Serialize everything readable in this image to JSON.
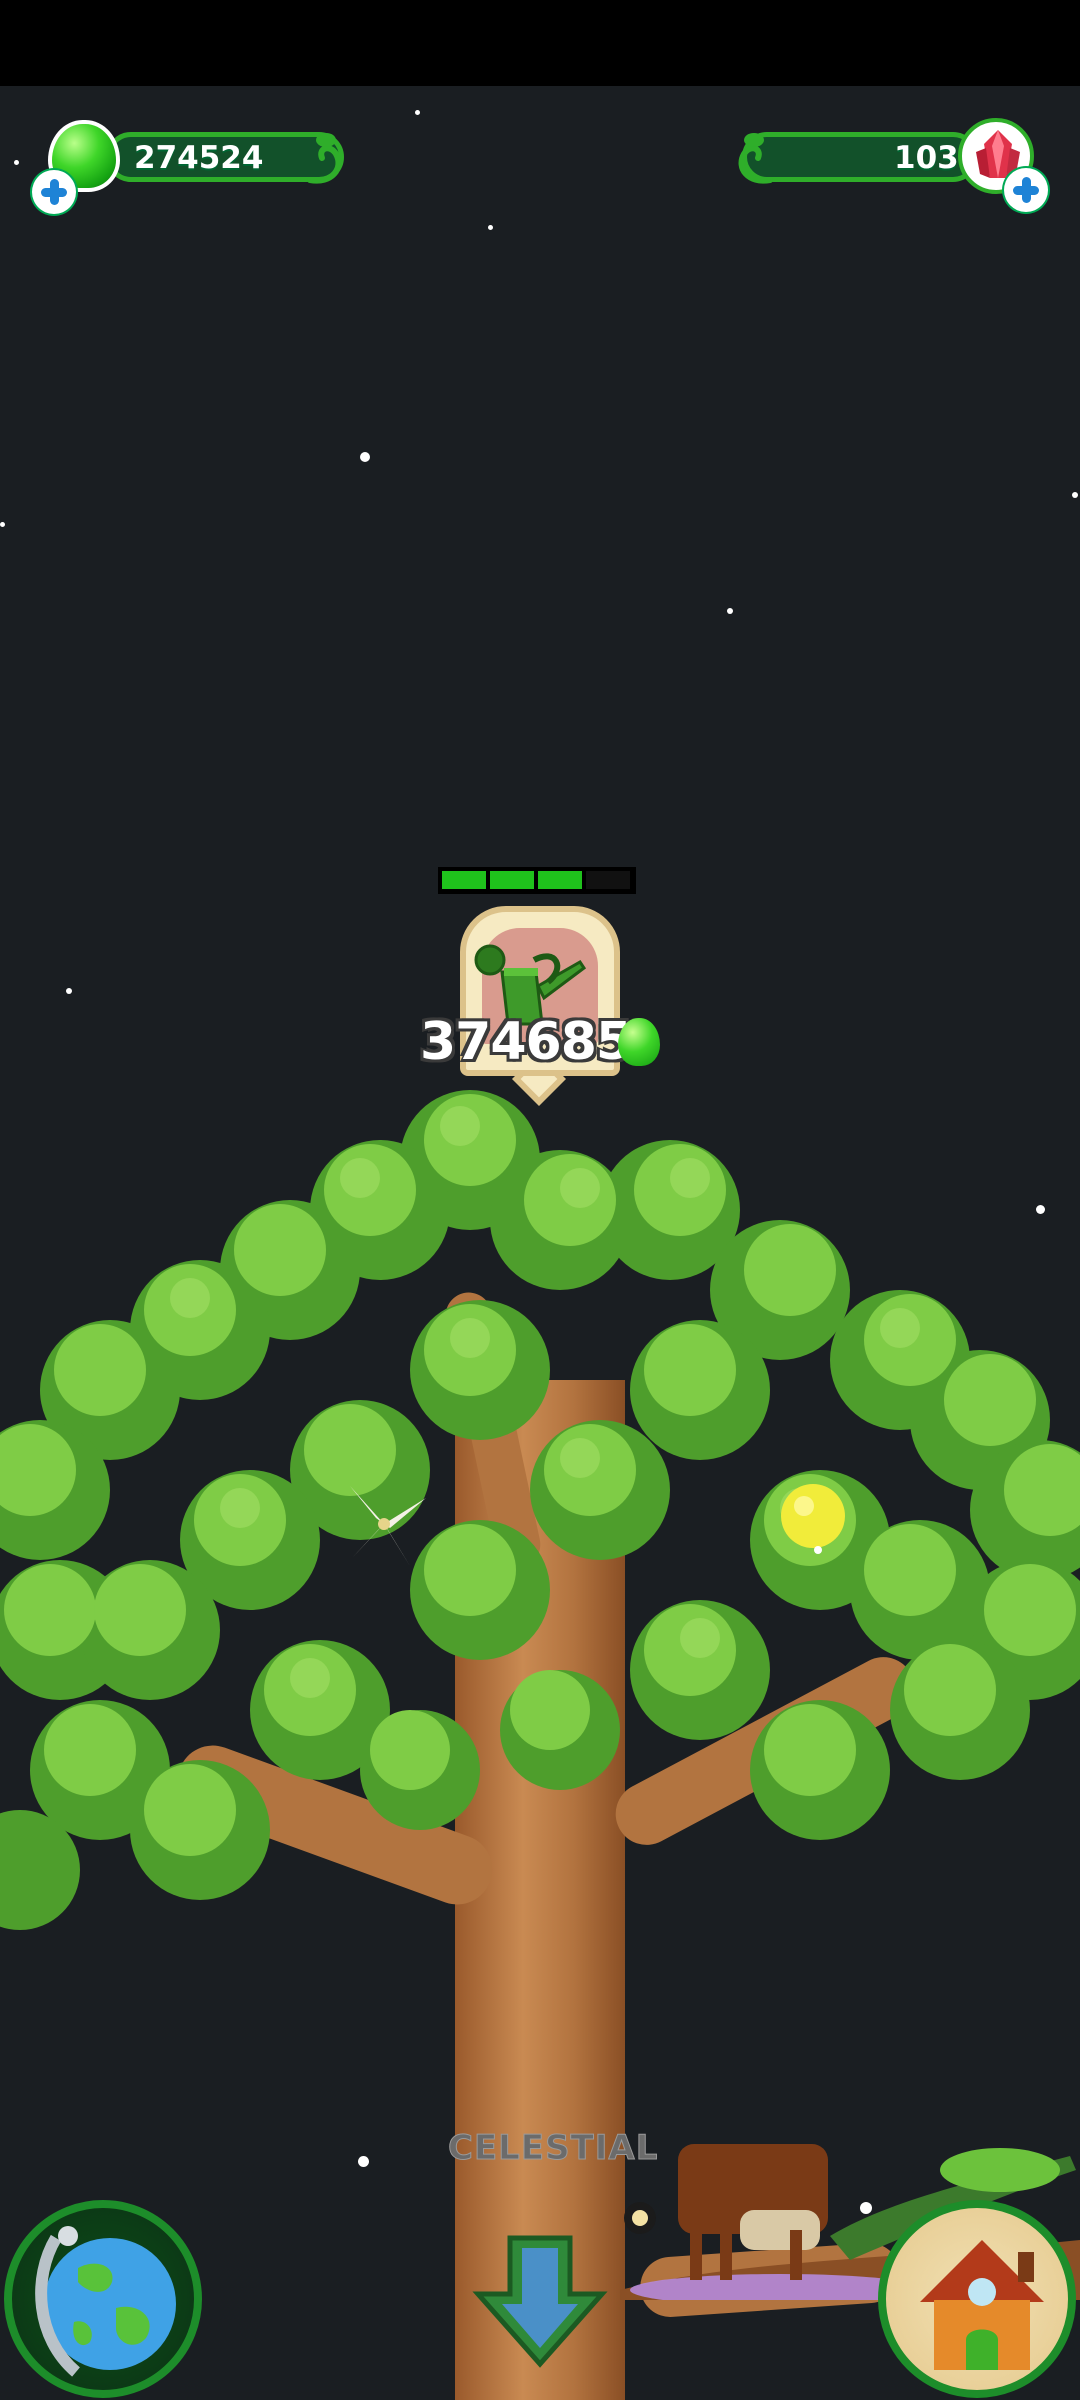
{
  "hud": {
    "gems": "274524",
    "crystals": "103",
    "gem_icon": "green-gem-icon",
    "crystal_icon": "red-crystal-icon"
  },
  "tree": {
    "progress_filled": 3,
    "progress_total": 4,
    "task_icon": "watering-can-icon",
    "reward": "374685",
    "zone_label": "CELESTIAL"
  },
  "nav": {
    "left_button_icon": "globe-icon",
    "center_button_icon": "down-arrow-icon",
    "right_button_icon": "house-icon"
  },
  "colors": {
    "background": "#1a1e22",
    "accent_green": "#2fae2a",
    "leaf": "#6cc23c"
  }
}
